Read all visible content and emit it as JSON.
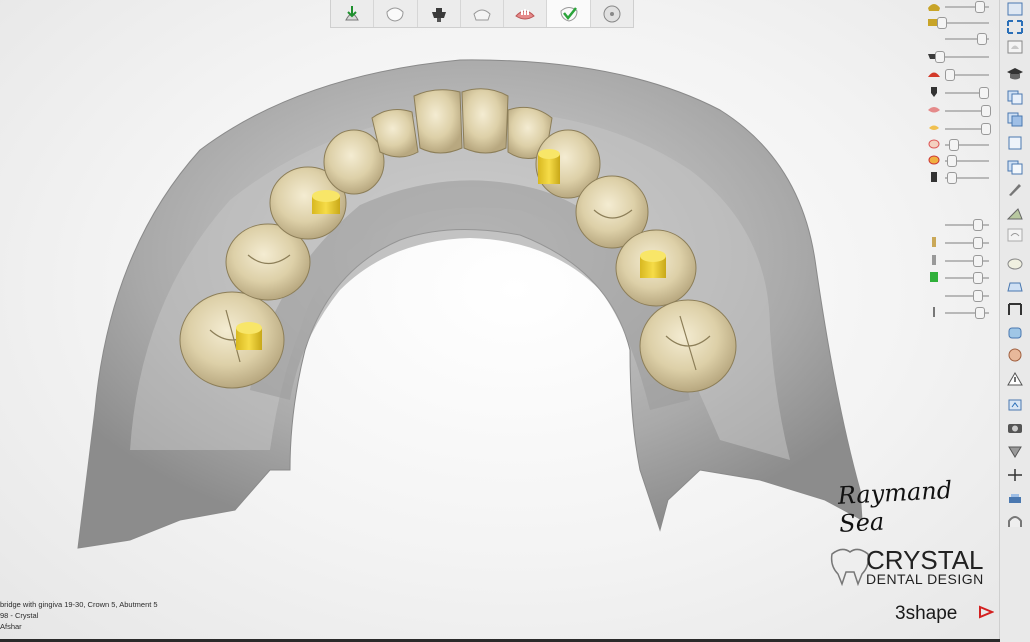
{
  "toolbar": {
    "steps": [
      {
        "icon": "upload-arrow-icon"
      },
      {
        "icon": "tooth-white-icon"
      },
      {
        "icon": "abutment-dark-icon"
      },
      {
        "icon": "crown-icon"
      },
      {
        "icon": "gingiva-pink-icon"
      },
      {
        "icon": "tooth-check-icon",
        "active": true
      },
      {
        "icon": "disc-icon"
      }
    ]
  },
  "right_tools": [
    "view-top-icon",
    "zoom-extents-icon",
    "tooth-view-icon",
    "graduation-cap-icon",
    "copy-icon",
    "layers-icon",
    "duplicate-icon",
    "files-icon",
    "pen-tool-icon",
    "sculpt-icon",
    "tooth-grid-icon",
    "gingiva-icon",
    "bridge-icon",
    "crown-measure-icon",
    "abutment-icon",
    "face-icon",
    "warning-icon",
    "cross-section-icon",
    "camera-icon",
    "shield-icon",
    "axis-icon",
    "printer-icon",
    "arch-icon"
  ],
  "sliders": [
    {
      "icon": "gold-crown-icon"
    },
    {
      "icon": "gold-bridge-icon"
    },
    {
      "icon": "abutment-dark-icon"
    },
    {
      "icon": "red-crown-icon"
    },
    {
      "icon": "implant-dark-icon"
    },
    {
      "icon": "gingiva-pink-icon"
    },
    {
      "icon": "gum-tooth-icon"
    },
    {
      "icon": "orange-tooth-icon"
    },
    {
      "icon": "pale-tooth-icon"
    },
    {
      "icon": "post-icon"
    },
    {
      "icon": "screw-icon"
    },
    {
      "icon": "implant-gray-icon"
    },
    {
      "icon": "green-implant-icon"
    },
    {
      "icon": "pin-icon"
    }
  ],
  "info": {
    "line1": "bridge with gingiva 19-30, Crown 5, Abutment 5",
    "line2": "98 - Crystal",
    "line3": "Afshar"
  },
  "branding": {
    "signature": "Raymand Sea",
    "name": "CRYSTAL",
    "sub": "DENTAL DESIGN",
    "vendor": "3shape"
  },
  "colors": {
    "teeth": "#e8dcb8",
    "abutment": "#f0d23a",
    "model": "#b8b8b8",
    "background": "#f3f3f3"
  }
}
